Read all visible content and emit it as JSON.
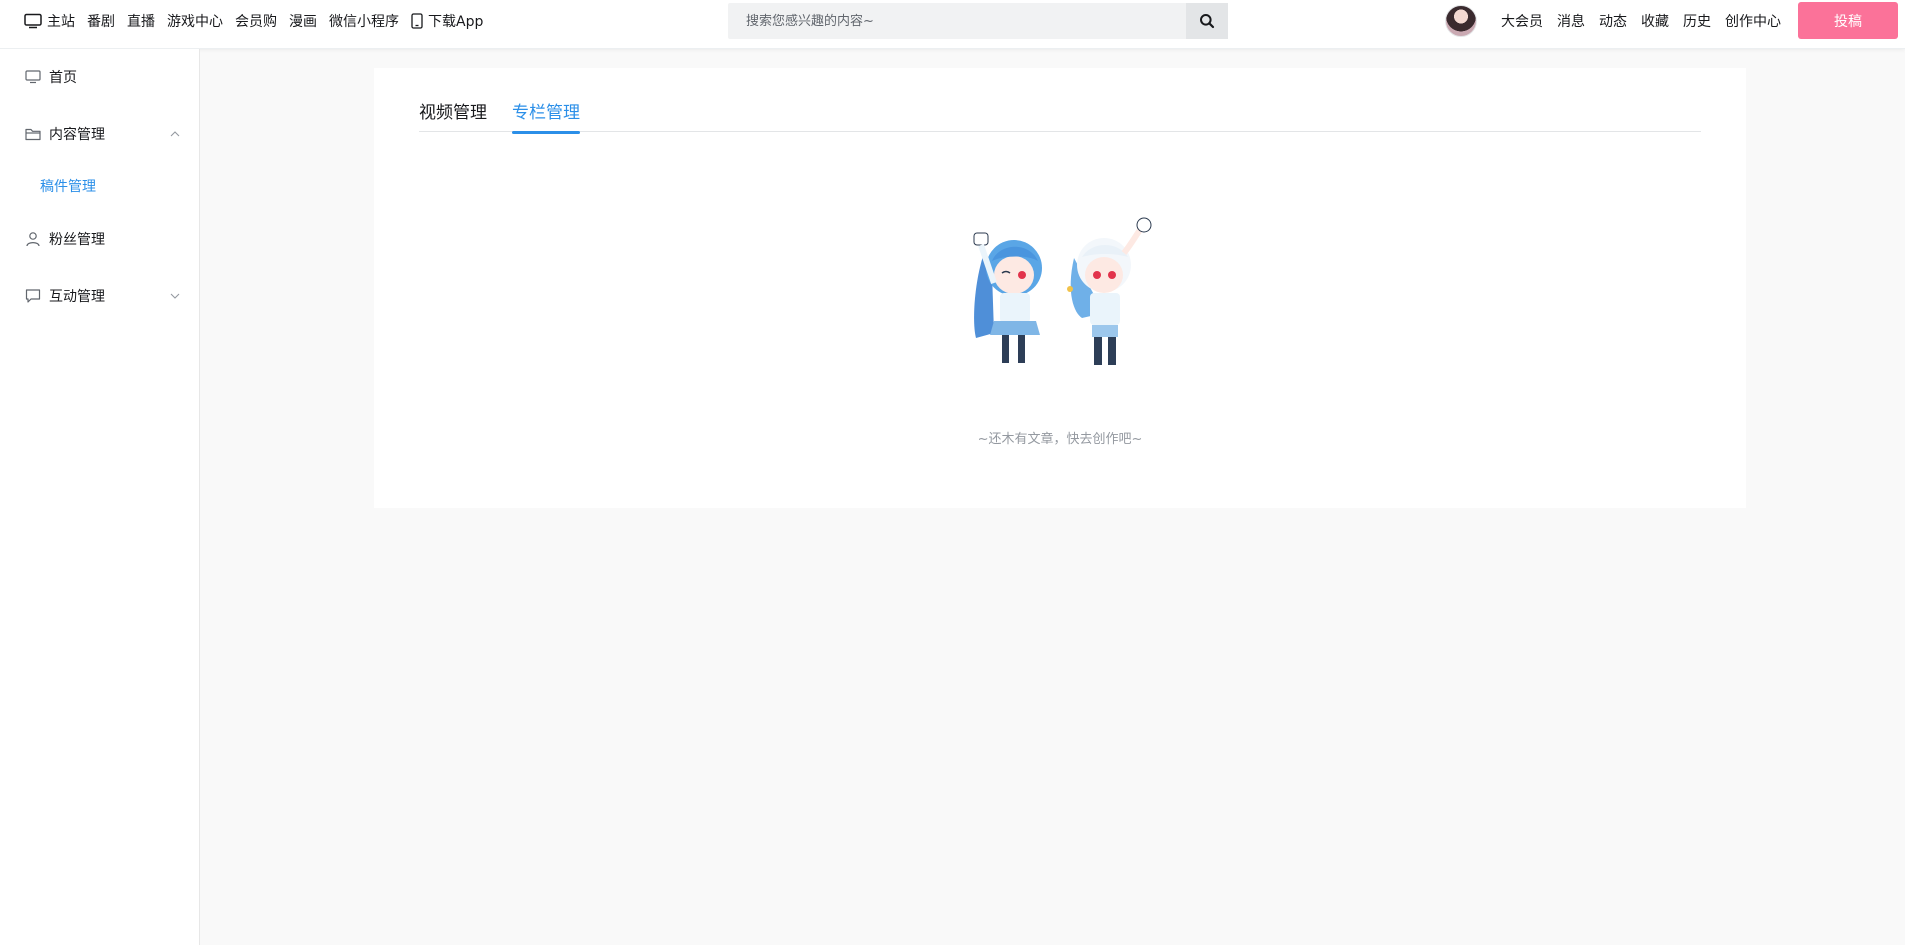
{
  "header": {
    "nav_left": [
      {
        "label": "主站",
        "icon": "tv-icon"
      },
      {
        "label": "番剧"
      },
      {
        "label": "直播"
      },
      {
        "label": "游戏中心"
      },
      {
        "label": "会员购"
      },
      {
        "label": "漫画"
      },
      {
        "label": "微信小程序"
      },
      {
        "label": "下载App",
        "icon": "phone-icon"
      }
    ],
    "search": {
      "placeholder": "搜索您感兴趣的内容~"
    },
    "nav_right": [
      "大会员",
      "消息",
      "动态",
      "收藏",
      "历史",
      "创作中心"
    ],
    "upload_label": "投稿"
  },
  "sidebar": {
    "items": [
      {
        "label": "首页",
        "icon": "monitor-icon"
      },
      {
        "label": "内容管理",
        "icon": "folder-icon",
        "expanded": true,
        "children": [
          {
            "label": "稿件管理",
            "active": true
          }
        ]
      },
      {
        "label": "粉丝管理",
        "icon": "user-icon"
      },
      {
        "label": "互动管理",
        "icon": "chat-icon",
        "expanded": false
      }
    ]
  },
  "main": {
    "tabs": [
      {
        "label": "视频管理",
        "active": false
      },
      {
        "label": "专栏管理",
        "active": true
      }
    ],
    "empty_text": "~还木有文章，快去创作吧~"
  },
  "colors": {
    "accent": "#2b8fe8",
    "brand_pink": "#fb7299",
    "page_bg": "#f9f9f9"
  }
}
